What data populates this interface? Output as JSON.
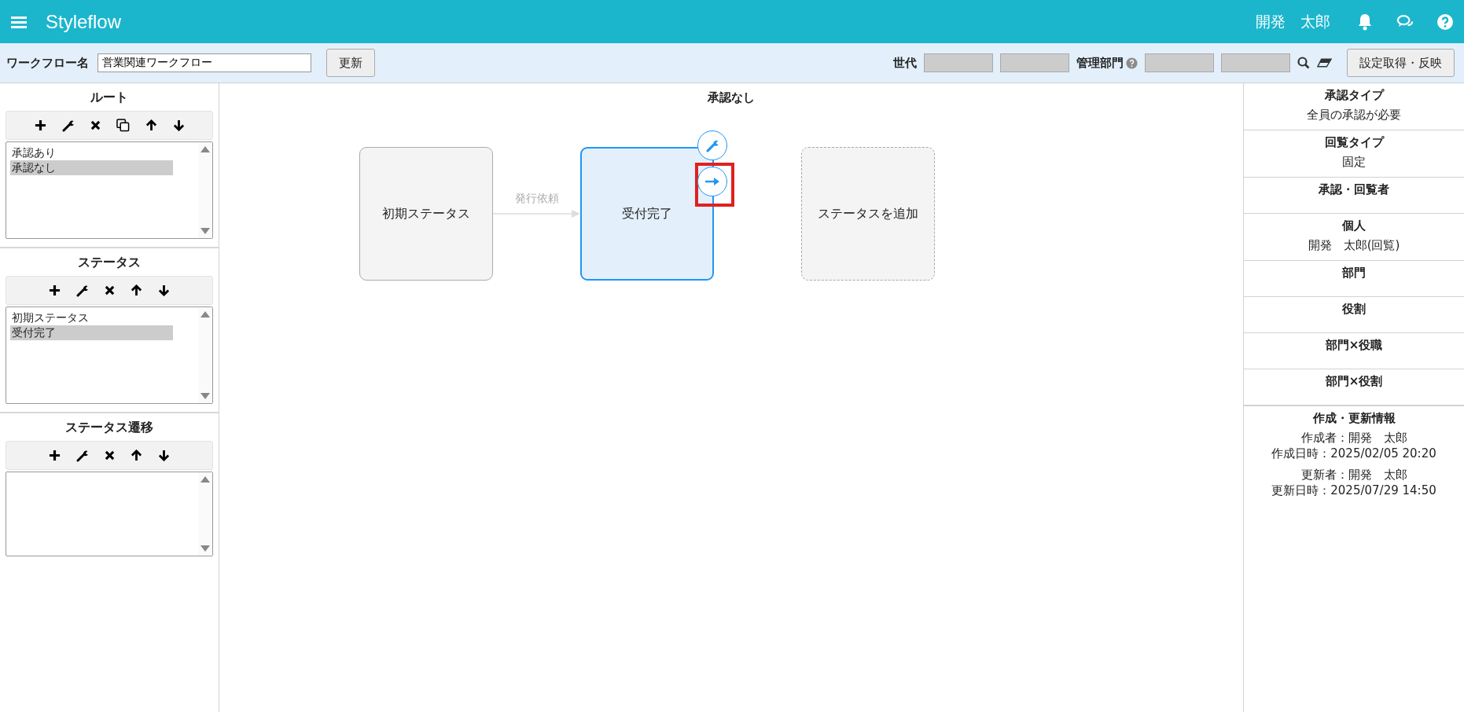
{
  "header": {
    "app_name": "Styleflow",
    "user_name": "開発　太郎"
  },
  "toolbar": {
    "workflow_name_label": "ワークフロー名",
    "workflow_name_value": "営業関連ワークフロー",
    "update_button": "更新",
    "generation_label": "世代",
    "generation_fields": [
      {
        "disabled": true
      },
      {
        "disabled": true
      }
    ],
    "department_label": "管理部門",
    "department_fields": [
      {
        "disabled": true
      },
      {
        "disabled": true
      }
    ],
    "apply_button": "設定取得・反映"
  },
  "sidebar": [
    {
      "title": "ルート",
      "tools": [
        {
          "kind": "add"
        },
        {
          "kind": "edit"
        },
        {
          "kind": "delete"
        },
        {
          "kind": "copy"
        },
        {
          "kind": "up"
        },
        {
          "kind": "down"
        }
      ],
      "items": [
        {
          "label": "承認あり",
          "selected": false
        },
        {
          "label": "承認なし",
          "selected": true
        }
      ]
    },
    {
      "title": "ステータス",
      "tools": [
        {
          "kind": "add"
        },
        {
          "kind": "edit"
        },
        {
          "kind": "delete"
        },
        {
          "kind": "up"
        },
        {
          "kind": "down"
        }
      ],
      "items": [
        {
          "label": "初期ステータス",
          "selected": false
        },
        {
          "label": "受付完了",
          "selected": true
        }
      ]
    },
    {
      "title": "ステータス遷移",
      "tools": [
        {
          "kind": "add"
        },
        {
          "kind": "edit"
        },
        {
          "kind": "delete"
        },
        {
          "kind": "up"
        },
        {
          "kind": "down"
        }
      ]
    }
  ],
  "canvas": {
    "title": "承認なし",
    "nodes": [
      {
        "label": "初期ステータス",
        "kind": "status",
        "selected": false
      },
      {
        "label": "受付完了",
        "kind": "status",
        "selected": true
      },
      {
        "label": "ステータスを追加",
        "kind": "add",
        "selected": false
      }
    ],
    "edges": [
      {
        "label": "発行依頼"
      }
    ]
  },
  "details": [
    {
      "title": "承認タイプ",
      "lines": [
        "全員の承認が必要"
      ]
    },
    {
      "title": "回覧タイプ",
      "lines": [
        "固定"
      ]
    },
    {
      "title": "承認・回覧者"
    },
    {
      "title": "個人",
      "lines": [
        "開発　太郎(回覧)"
      ]
    },
    {
      "title": "部門"
    },
    {
      "title": "役割"
    },
    {
      "title": "部門×役職"
    },
    {
      "title": "部門×役割"
    }
  ],
  "info": {
    "title": "作成・更新情報",
    "groups": [
      [
        "作成者：開発　太郎",
        "作成日時：2025/02/05 20:20"
      ],
      [
        "更新者：開発　太郎",
        "更新日時：2025/07/29 14:50"
      ]
    ]
  }
}
